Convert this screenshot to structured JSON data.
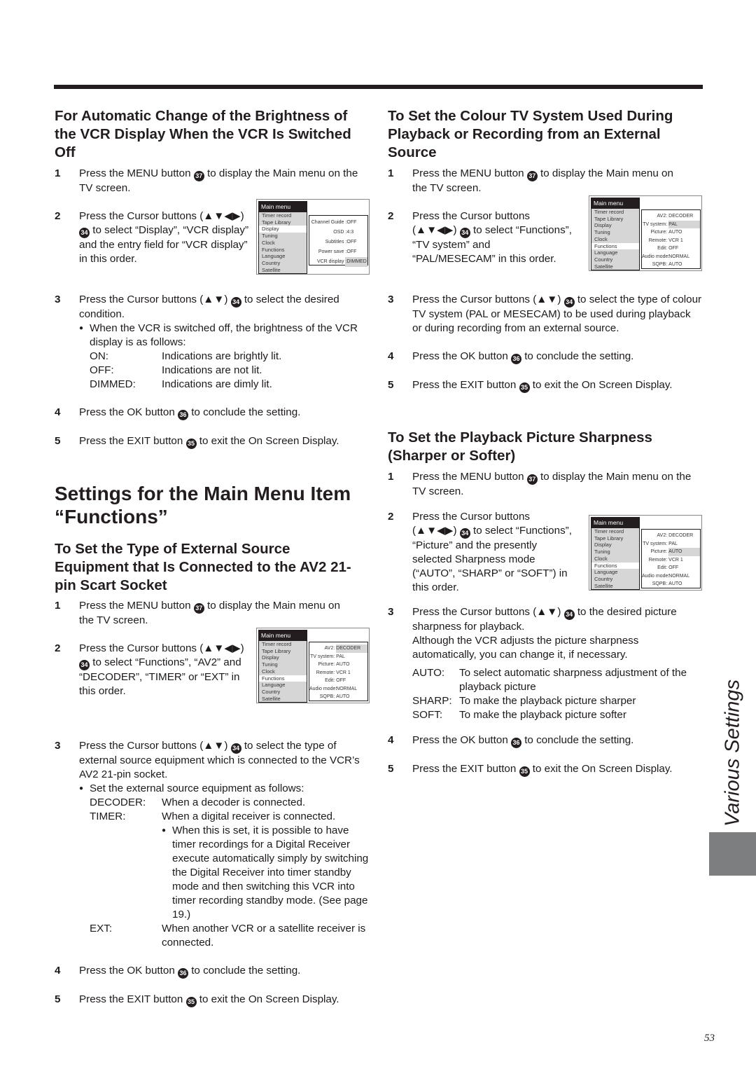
{
  "left": {
    "brightness": {
      "heading": "For Automatic Change of the Brightness of the VCR Display When the VCR Is Switched Off",
      "steps": [
        {
          "num": "1",
          "pre": "Press the MENU button ",
          "badge": "37",
          "post": " to display the Main menu on the TV screen."
        },
        {
          "num": "2",
          "pre": "Press the Cursor buttons (▲▼◀▶) ",
          "badge": "34",
          "post": " to select “Display”, “VCR display” and the entry field for “VCR display” in this order."
        },
        {
          "num": "3",
          "pre": "Press the Cursor buttons (▲▼) ",
          "badge": "34",
          "post": " to select the desired condition."
        },
        {
          "num": "4",
          "pre": "Press the OK button ",
          "badge": "36",
          "post": " to conclude the setting."
        },
        {
          "num": "5",
          "pre": "Press the EXIT button ",
          "badge": "35",
          "post": " to exit the On Screen Display."
        }
      ],
      "bullet": "When the VCR is switched off, the brightness of the VCR display is as follows:",
      "options": [
        {
          "term": "ON:",
          "desc": "Indications are brightly lit."
        },
        {
          "term": "OFF:",
          "desc": "Indications are not lit."
        },
        {
          "term": "DIMMED:",
          "desc": "Indications are dimly lit."
        }
      ],
      "osd": {
        "title": "Main menu",
        "items": [
          "Timer record",
          "Tape Library",
          "Display",
          "Tuning",
          "Clock",
          "Functions",
          "Language",
          "Country",
          "Satellite"
        ],
        "selected": "Display",
        "rows": [
          {
            "k": "Channel Guide",
            "v": ":OFF"
          },
          {
            "k": "OSD",
            "v": ":4:3"
          },
          {
            "k": "Subtitles",
            "v": ":OFF"
          },
          {
            "k": "Power save",
            "v": ":OFF"
          },
          {
            "k": "VCR display",
            "v": ":DIMMED"
          }
        ]
      }
    },
    "main_heading": "Settings for the Main Menu Item “Functions”",
    "external": {
      "heading": "To Set the Type of External Source Equipment that Is Connected to the AV2 21-pin Scart Socket",
      "steps": [
        {
          "num": "1",
          "pre": "Press the MENU button ",
          "badge": "37",
          "post": " to display the Main menu on the TV screen."
        },
        {
          "num": "2",
          "pre": "Press the Cursor buttons (▲▼◀▶) ",
          "badge": "34",
          "post": " to select “Functions”, “AV2” and “DECODER”, “TIMER” or “EXT” in this order."
        },
        {
          "num": "3",
          "pre": "Press the Cursor buttons (▲▼) ",
          "badge": "34",
          "post": " to select the type of external source equipment which is connected to the VCR’s AV2 21-pin socket."
        },
        {
          "num": "4",
          "pre": "Press the OK button ",
          "badge": "36",
          "post": " to conclude the setting."
        },
        {
          "num": "5",
          "pre": "Press the EXIT button ",
          "badge": "35",
          "post": " to exit the On Screen Display."
        }
      ],
      "bullet": "Set the external source equipment as follows:",
      "options": [
        {
          "term": "DECODER:",
          "desc": "When a decoder is connected."
        },
        {
          "term": "TIMER:",
          "desc": "When a digital receiver is connected."
        },
        {
          "term": "EXT:",
          "desc": "When another VCR or a satellite receiver is connected."
        }
      ],
      "timer_note": "When this is set, it is possible to have timer recordings for a Digital Receiver execute automatically simply by switching the Digital Receiver into timer standby mode and then switching this VCR into timer recording standby mode. (See page 19.)"
    }
  },
  "right": {
    "colour": {
      "heading": "To Set the Colour TV System Used During Playback or Recording from an External Source",
      "steps": [
        {
          "num": "1",
          "pre": "Press the MENU button ",
          "badge": "37",
          "post": " to display the Main menu on the TV screen."
        },
        {
          "num": "2",
          "pre": "Press the Cursor buttons (▲▼◀▶) ",
          "badge": "34",
          "post": " to select “Functions”, “TV system” and “PAL/MESECAM” in this order."
        },
        {
          "num": "3",
          "pre": "Press the Cursor buttons (▲▼) ",
          "badge": "34",
          "post": " to select the type of colour TV system (PAL or MESECAM) to be used during playback or during recording from an external source."
        },
        {
          "num": "4",
          "pre": "Press the OK button ",
          "badge": "36",
          "post": " to conclude the setting."
        },
        {
          "num": "5",
          "pre": "Press the EXIT button ",
          "badge": "35",
          "post": " to exit the On Screen Display."
        }
      ]
    },
    "sharpness": {
      "heading": "To Set the Playback Picture Sharpness (Sharper or Softer)",
      "steps": [
        {
          "num": "1",
          "pre": "Press the MENU button ",
          "badge": "37",
          "post": " to display the Main menu on the TV screen."
        },
        {
          "num": "2",
          "pre": "Press the Cursor buttons (▲▼◀▶) ",
          "badge": "34",
          "post": " to select “Functions”, “Picture” and the presently selected Sharpness mode (“AUTO”, “SHARP” or “SOFT”) in this order."
        },
        {
          "num": "3",
          "pre": "Press the Cursor buttons (▲▼) ",
          "badge": "34",
          "post": " to the desired picture sharpness for playback."
        },
        {
          "num": "4",
          "pre": "Press the OK button ",
          "badge": "36",
          "post": " to conclude the setting."
        },
        {
          "num": "5",
          "pre": "Press the EXIT button ",
          "badge": "35",
          "post": " to exit the On Screen Display."
        }
      ],
      "note": "Although the VCR adjusts the picture sharpness automatically, you can change it, if necessary.",
      "options": [
        {
          "term": "AUTO:",
          "desc": "To select automatic sharpness adjustment of the playback picture"
        },
        {
          "term": "SHARP:",
          "desc": "To make the playback picture sharper"
        },
        {
          "term": "SOFT:",
          "desc": "To make the playback picture softer"
        }
      ]
    }
  },
  "functions_osd": {
    "title": "Main menu",
    "items": [
      "Timer record",
      "Tape Library",
      "Display",
      "Tuning",
      "Clock",
      "Functions",
      "Language",
      "Country",
      "Satellite"
    ],
    "selected": "Functions",
    "rows": [
      {
        "k": "AV2:",
        "v": "DECODER"
      },
      {
        "k": "TV system:",
        "v": "PAL"
      },
      {
        "k": "Picture:",
        "v": "AUTO"
      },
      {
        "k": "Remote:",
        "v": "VCR 1"
      },
      {
        "k": "Edit:",
        "v": "OFF"
      },
      {
        "k": "Audio mode:",
        "v": "NORMAL"
      },
      {
        "k": "SQPB:",
        "v": "AUTO"
      }
    ],
    "highlight_colour": "TV system:",
    "highlight_sharpness": "Picture:",
    "highlight_external": "AV2:"
  },
  "side_label": "Various Settings",
  "page_number": "53",
  "colors": {
    "text": "#231d1f",
    "tab_gray": "#7d7e80",
    "menu_gray": "#d6d6d6"
  }
}
